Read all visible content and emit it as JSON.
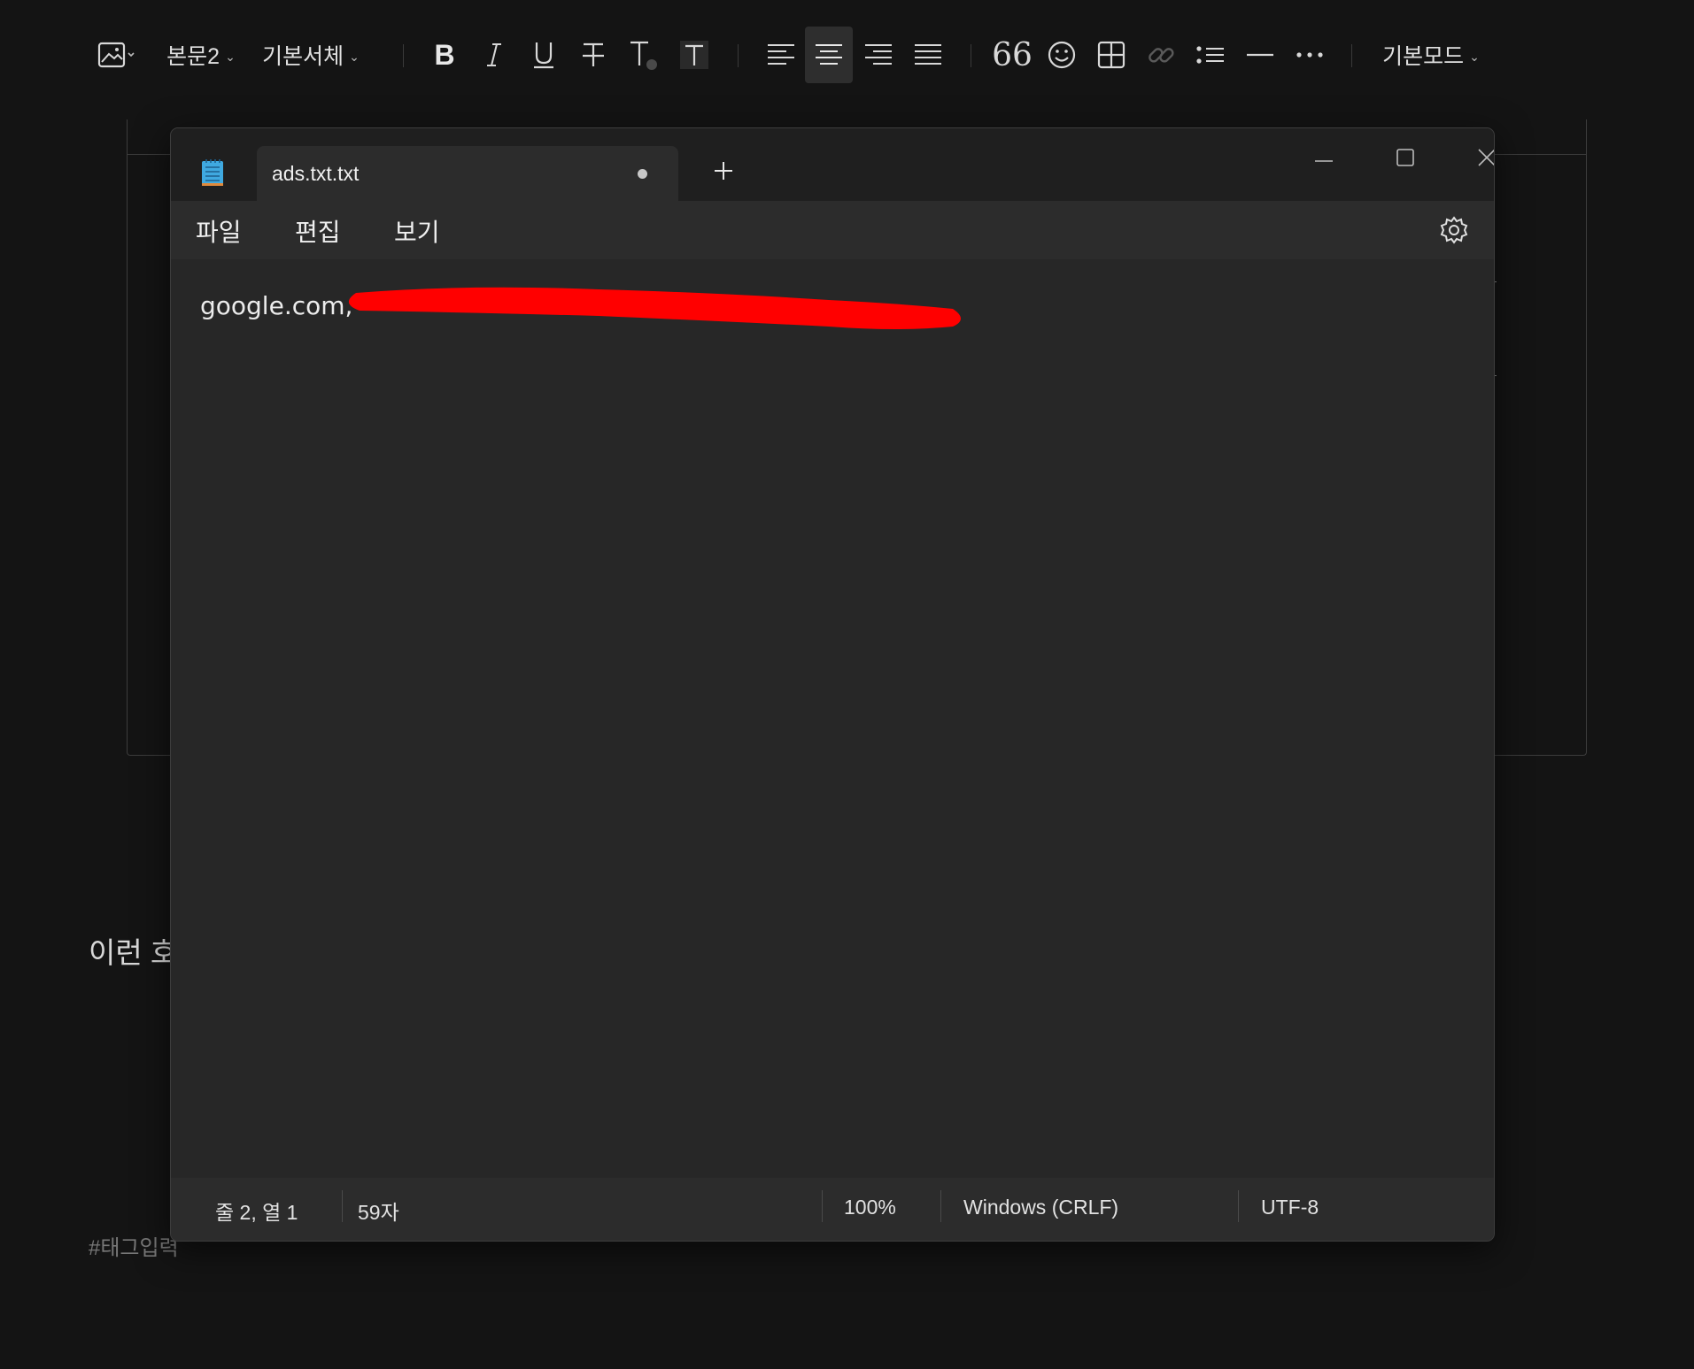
{
  "toolbar": {
    "paragraph_style": "본문2",
    "font_family": "기본서체",
    "mode": "기본모드",
    "active_align": "center"
  },
  "document": {
    "body_text": "이런 호",
    "tag_placeholder": "#태그입력"
  },
  "notepad": {
    "tab_title": "ads.txt.txt",
    "unsaved": true,
    "menu": {
      "file": "파일",
      "edit": "편집",
      "view": "보기"
    },
    "content_visible": "google.com,",
    "status": {
      "position": "줄 2, 열 1",
      "char_count": "59자",
      "zoom": "100%",
      "line_ending": "Windows (CRLF)",
      "encoding": "UTF-8"
    }
  },
  "colors": {
    "redaction": "#ff0000",
    "accent_icon": "#3fa9e0"
  },
  "icons": [
    "image-icon",
    "bold-icon",
    "italic-icon",
    "underline-icon",
    "strikethrough-icon",
    "text-color-icon",
    "text-background-icon",
    "align-left-icon",
    "align-center-icon",
    "align-right-icon",
    "align-justify-icon",
    "quote-icon",
    "emoji-icon",
    "table-icon",
    "link-icon",
    "list-icon",
    "horizontal-rule-icon",
    "more-icon",
    "notepad-icon",
    "add-tab-icon",
    "minimize-icon",
    "maximize-icon",
    "close-icon",
    "gear-icon"
  ]
}
